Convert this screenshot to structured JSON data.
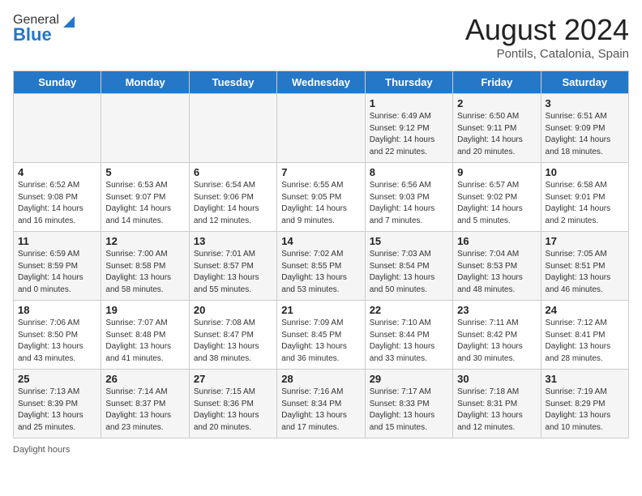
{
  "header": {
    "logo_general": "General",
    "logo_blue": "Blue",
    "month_title": "August 2024",
    "location": "Pontils, Catalonia, Spain"
  },
  "days_of_week": [
    "Sunday",
    "Monday",
    "Tuesday",
    "Wednesday",
    "Thursday",
    "Friday",
    "Saturday"
  ],
  "weeks": [
    [
      {
        "day": "",
        "info": ""
      },
      {
        "day": "",
        "info": ""
      },
      {
        "day": "",
        "info": ""
      },
      {
        "day": "",
        "info": ""
      },
      {
        "day": "1",
        "info": "Sunrise: 6:49 AM\nSunset: 9:12 PM\nDaylight: 14 hours\nand 22 minutes."
      },
      {
        "day": "2",
        "info": "Sunrise: 6:50 AM\nSunset: 9:11 PM\nDaylight: 14 hours\nand 20 minutes."
      },
      {
        "day": "3",
        "info": "Sunrise: 6:51 AM\nSunset: 9:09 PM\nDaylight: 14 hours\nand 18 minutes."
      }
    ],
    [
      {
        "day": "4",
        "info": "Sunrise: 6:52 AM\nSunset: 9:08 PM\nDaylight: 14 hours\nand 16 minutes."
      },
      {
        "day": "5",
        "info": "Sunrise: 6:53 AM\nSunset: 9:07 PM\nDaylight: 14 hours\nand 14 minutes."
      },
      {
        "day": "6",
        "info": "Sunrise: 6:54 AM\nSunset: 9:06 PM\nDaylight: 14 hours\nand 12 minutes."
      },
      {
        "day": "7",
        "info": "Sunrise: 6:55 AM\nSunset: 9:05 PM\nDaylight: 14 hours\nand 9 minutes."
      },
      {
        "day": "8",
        "info": "Sunrise: 6:56 AM\nSunset: 9:03 PM\nDaylight: 14 hours\nand 7 minutes."
      },
      {
        "day": "9",
        "info": "Sunrise: 6:57 AM\nSunset: 9:02 PM\nDaylight: 14 hours\nand 5 minutes."
      },
      {
        "day": "10",
        "info": "Sunrise: 6:58 AM\nSunset: 9:01 PM\nDaylight: 14 hours\nand 2 minutes."
      }
    ],
    [
      {
        "day": "11",
        "info": "Sunrise: 6:59 AM\nSunset: 8:59 PM\nDaylight: 14 hours\nand 0 minutes."
      },
      {
        "day": "12",
        "info": "Sunrise: 7:00 AM\nSunset: 8:58 PM\nDaylight: 13 hours\nand 58 minutes."
      },
      {
        "day": "13",
        "info": "Sunrise: 7:01 AM\nSunset: 8:57 PM\nDaylight: 13 hours\nand 55 minutes."
      },
      {
        "day": "14",
        "info": "Sunrise: 7:02 AM\nSunset: 8:55 PM\nDaylight: 13 hours\nand 53 minutes."
      },
      {
        "day": "15",
        "info": "Sunrise: 7:03 AM\nSunset: 8:54 PM\nDaylight: 13 hours\nand 50 minutes."
      },
      {
        "day": "16",
        "info": "Sunrise: 7:04 AM\nSunset: 8:53 PM\nDaylight: 13 hours\nand 48 minutes."
      },
      {
        "day": "17",
        "info": "Sunrise: 7:05 AM\nSunset: 8:51 PM\nDaylight: 13 hours\nand 46 minutes."
      }
    ],
    [
      {
        "day": "18",
        "info": "Sunrise: 7:06 AM\nSunset: 8:50 PM\nDaylight: 13 hours\nand 43 minutes."
      },
      {
        "day": "19",
        "info": "Sunrise: 7:07 AM\nSunset: 8:48 PM\nDaylight: 13 hours\nand 41 minutes."
      },
      {
        "day": "20",
        "info": "Sunrise: 7:08 AM\nSunset: 8:47 PM\nDaylight: 13 hours\nand 38 minutes."
      },
      {
        "day": "21",
        "info": "Sunrise: 7:09 AM\nSunset: 8:45 PM\nDaylight: 13 hours\nand 36 minutes."
      },
      {
        "day": "22",
        "info": "Sunrise: 7:10 AM\nSunset: 8:44 PM\nDaylight: 13 hours\nand 33 minutes."
      },
      {
        "day": "23",
        "info": "Sunrise: 7:11 AM\nSunset: 8:42 PM\nDaylight: 13 hours\nand 30 minutes."
      },
      {
        "day": "24",
        "info": "Sunrise: 7:12 AM\nSunset: 8:41 PM\nDaylight: 13 hours\nand 28 minutes."
      }
    ],
    [
      {
        "day": "25",
        "info": "Sunrise: 7:13 AM\nSunset: 8:39 PM\nDaylight: 13 hours\nand 25 minutes."
      },
      {
        "day": "26",
        "info": "Sunrise: 7:14 AM\nSunset: 8:37 PM\nDaylight: 13 hours\nand 23 minutes."
      },
      {
        "day": "27",
        "info": "Sunrise: 7:15 AM\nSunset: 8:36 PM\nDaylight: 13 hours\nand 20 minutes."
      },
      {
        "day": "28",
        "info": "Sunrise: 7:16 AM\nSunset: 8:34 PM\nDaylight: 13 hours\nand 17 minutes."
      },
      {
        "day": "29",
        "info": "Sunrise: 7:17 AM\nSunset: 8:33 PM\nDaylight: 13 hours\nand 15 minutes."
      },
      {
        "day": "30",
        "info": "Sunrise: 7:18 AM\nSunset: 8:31 PM\nDaylight: 13 hours\nand 12 minutes."
      },
      {
        "day": "31",
        "info": "Sunrise: 7:19 AM\nSunset: 8:29 PM\nDaylight: 13 hours\nand 10 minutes."
      }
    ]
  ],
  "footer": {
    "daylight_hours": "Daylight hours"
  }
}
